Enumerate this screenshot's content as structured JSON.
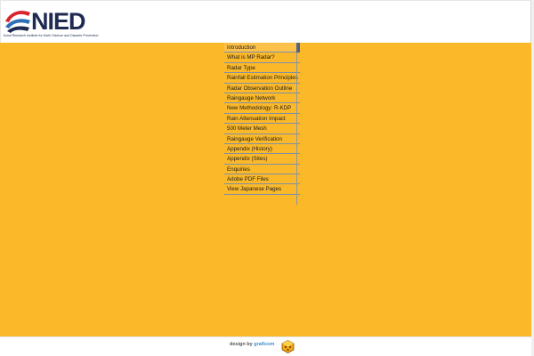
{
  "header": {
    "logo_word": "NIED",
    "logo_subtitle": "tional Research Institute for Earth Science and Disaster Prevention"
  },
  "menu": {
    "items": [
      {
        "label": "Introduction"
      },
      {
        "label": "What is MP Radar?"
      },
      {
        "label": "Radar Type"
      },
      {
        "label": "Rainfall Estimation Principles"
      },
      {
        "label": "Radar Observation Outline"
      },
      {
        "label": "Raingauge Network"
      },
      {
        "label": "New Methodology: R-KDP"
      },
      {
        "label": "Rain Attenuation Impact"
      },
      {
        "label": "500 Meter Mesh"
      },
      {
        "label": "Raingauge Verification"
      },
      {
        "label": "Appendix (History)"
      },
      {
        "label": "Appendix (Sites)"
      },
      {
        "label": "Enquiries"
      },
      {
        "label": "Adobe PDF Files"
      },
      {
        "label": "View Japanese Pages"
      }
    ]
  },
  "footer": {
    "credit_prefix": "design by",
    "credit_brand": "graficom",
    "credit_icon": "graficom-logo-icon"
  },
  "colors": {
    "background": "#fbb829",
    "highlight": "#fdc14a",
    "logo_navy": "#1f2a52",
    "logo_red": "#d8242b",
    "logo_blue": "#2d6fb8"
  }
}
